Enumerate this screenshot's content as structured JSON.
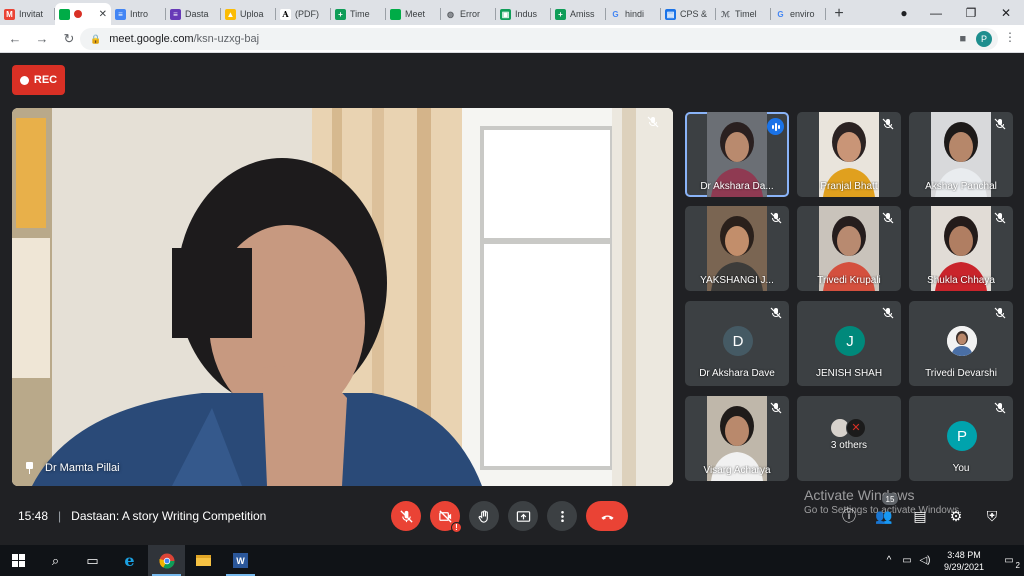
{
  "browser": {
    "tabs": [
      {
        "label": "Invitat",
        "icon": "gmail-icon",
        "color": "#ea4335",
        "glyph": "M"
      },
      {
        "label": "",
        "icon": "meet-icon",
        "color": "#00ac47",
        "glyph": "",
        "active": true
      },
      {
        "label": "Intro",
        "icon": "docs-icon",
        "color": "#4285f4",
        "glyph": "≡"
      },
      {
        "label": "Dasta",
        "icon": "forms-icon",
        "color": "#673ab7",
        "glyph": "≡"
      },
      {
        "label": "Uploa",
        "icon": "drive-icon",
        "color": "#fbbc04",
        "glyph": "▲"
      },
      {
        "label": "(PDF)",
        "icon": "academia-icon",
        "color": "#ffffff",
        "glyph": "A"
      },
      {
        "label": "Time",
        "icon": "sheets-icon",
        "color": "#0f9d58",
        "glyph": "+"
      },
      {
        "label": "Meet",
        "icon": "meet-icon",
        "color": "#00ac47",
        "glyph": ""
      },
      {
        "label": "Error",
        "icon": "globe-icon",
        "color": "#5f6368",
        "glyph": "◍"
      },
      {
        "label": "Indus",
        "icon": "classroom-icon",
        "color": "#0f9d58",
        "glyph": "▣"
      },
      {
        "label": "Amiss",
        "icon": "sheets-icon",
        "color": "#0f9d58",
        "glyph": "+"
      },
      {
        "label": "hindi",
        "icon": "google-icon",
        "color": "#4285f4",
        "glyph": "G"
      },
      {
        "label": "CPS &",
        "icon": "card-icon",
        "color": "#1a73e8",
        "glyph": "▤"
      },
      {
        "label": "Timel",
        "icon": "timeline-icon",
        "color": "#5f6368",
        "glyph": "ℳ"
      },
      {
        "label": "enviro",
        "icon": "google-icon",
        "color": "#4285f4",
        "glyph": "G"
      }
    ],
    "url_host": "meet.google.com",
    "url_path": "/ksn-uzxg-baj",
    "profile_initial": "P"
  },
  "meet": {
    "rec_label": "REC",
    "main_speaker": "Dr Mamta Pillai",
    "participants": [
      {
        "name": "Dr Akshara Da...",
        "type": "video",
        "speaking": true
      },
      {
        "name": "Pranjal Bhatt",
        "type": "video"
      },
      {
        "name": "Akshay Panchal",
        "type": "video"
      },
      {
        "name": "YAKSHANGI J...",
        "type": "video"
      },
      {
        "name": "Trivedi Krupali",
        "type": "video"
      },
      {
        "name": "Shukla Chhaya",
        "type": "video"
      },
      {
        "name": "Dr Akshara Dave",
        "type": "avatar",
        "initial": "D",
        "color": "#455a64"
      },
      {
        "name": "JENISH SHAH",
        "type": "avatar",
        "initial": "J",
        "color": "#00897b"
      },
      {
        "name": "Trivedi Devarshi",
        "type": "photo-avatar"
      },
      {
        "name": "Visarg Acharya",
        "type": "video"
      },
      {
        "name": "3 others",
        "type": "others"
      },
      {
        "name": "You",
        "type": "avatar",
        "initial": "P",
        "color": "#00a3ad"
      }
    ],
    "time": "15:48",
    "meeting_title": "Dastaan: A story Writing Competition",
    "people_count": "15",
    "activate_line1": "Activate Windows",
    "activate_line2": "Go to Settings to activate Windows."
  },
  "taskbar": {
    "time": "3:48 PM",
    "date": "9/29/2021",
    "notification_count": "2"
  }
}
